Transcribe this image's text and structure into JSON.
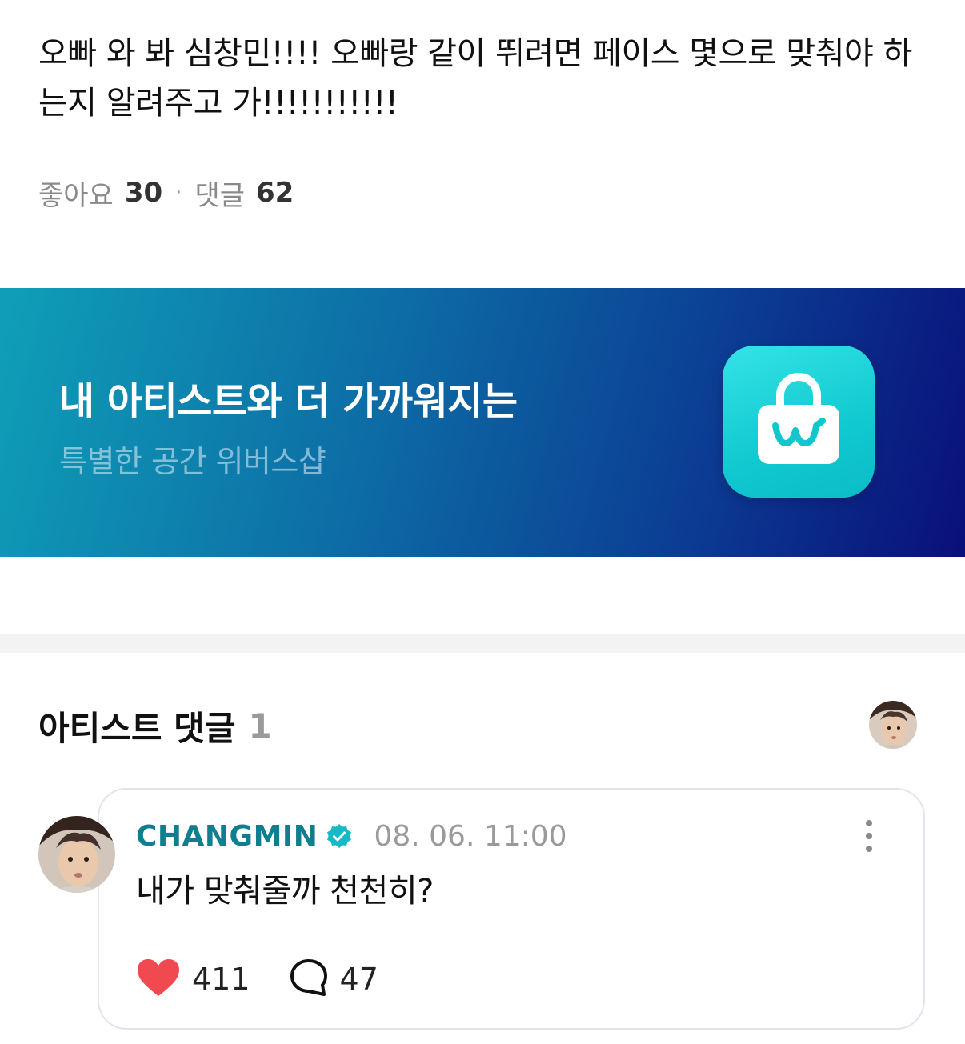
{
  "post": {
    "text": "오빠 와 봐 심창민!!!! 오빠랑 같이 뛰려면 페이스 몇으로 맞춰야 하는지 알려주고 가!!!!!!!!!!!"
  },
  "stats": {
    "likes_label": "좋아요",
    "likes_count": "30",
    "separator": "·",
    "comments_label": "댓글",
    "comments_count": "62"
  },
  "banner": {
    "title": "내 아티스트와 더 가까워지는",
    "subtitle": "특별한 공간 위버스샵",
    "icon": "weverse-shop-bag-icon",
    "colors": {
      "start": "#0f9fb8",
      "end": "#0a0f7a",
      "icon_bg": "#1fd2d6"
    }
  },
  "artist_comments": {
    "title": "아티스트 댓글",
    "count": "1"
  },
  "comment": {
    "author": "CHANGMIN",
    "verified_icon": "verified-badge-icon",
    "timestamp": "08. 06. 11:00",
    "text": "내가 맞춰줄까 천천히?",
    "likes": "411",
    "replies": "47",
    "accent_color": "#0f7f8f",
    "like_color": "#f0494f"
  }
}
